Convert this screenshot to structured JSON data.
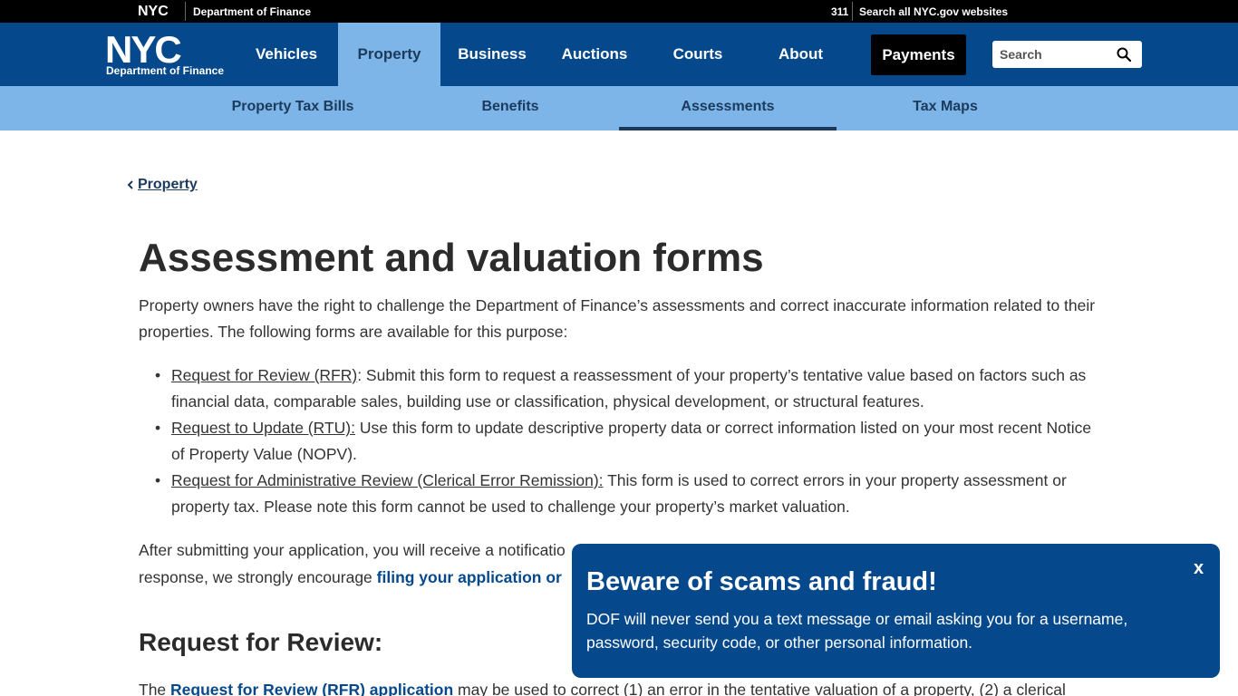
{
  "topbar": {
    "logo_text": "NYC",
    "department": "Department of Finance",
    "link_311": "311",
    "search_all": "Search all NYC.gov websites"
  },
  "header": {
    "logo_big": "NYC",
    "logo_sub": "Department of Finance",
    "nav": [
      {
        "label": "Vehicles"
      },
      {
        "label": "Property"
      },
      {
        "label": "Business"
      },
      {
        "label": "Auctions"
      },
      {
        "label": "Courts"
      },
      {
        "label": "About"
      }
    ],
    "payments_label": "Payments",
    "search_placeholder": "Search"
  },
  "subnav": [
    {
      "label": "Property Tax Bills"
    },
    {
      "label": "Benefits"
    },
    {
      "label": "Assessments"
    },
    {
      "label": "Tax Maps"
    }
  ],
  "breadcrumb": {
    "back_label": "Property"
  },
  "page": {
    "title": "Assessment and valuation forms",
    "intro": "Property owners have the right to challenge the Department of Finance’s assessments and correct inaccurate information related to their properties. The following forms are available for this purpose:",
    "forms": [
      {
        "link": "Request for Review (RFR)",
        "text": ": Submit this form to request a reassessment of your property’s tentative value based on factors such as financial data, comparable sales, building use or classification, physical development, or structural features."
      },
      {
        "link": "Request to Update (RTU):",
        "text": " Use this form to update descriptive property data or correct information listed on your most recent Notice of Property Value (NOPV)."
      },
      {
        "link": "Request for Administrative Review (Clerical Error Remission):",
        "text": " This form is used to correct errors in your property assessment or property tax. Please note this form cannot be used to challenge your property’s market valuation."
      }
    ],
    "after_text_1": "After submitting your application, you will receive a notificatio",
    "after_text_2": "response, we strongly encourage ",
    "after_link": "filing your application or",
    "section_heading": "Request for Review:",
    "rfr_prefix": "The ",
    "rfr_link": "Request for Review (RFR) application",
    "rfr_text": " may be used to correct (1) an error in the tentative valuation of a property, (2) a clerical"
  },
  "alert": {
    "title": "Beware of scams and fraud!",
    "body": "DOF will never send you a text message or email asking you for a username, password, security code, or other personal information.",
    "close_label": "x"
  },
  "colors": {
    "brand_blue": "#05498c",
    "light_blue": "#7db5e8",
    "black": "#000000"
  }
}
